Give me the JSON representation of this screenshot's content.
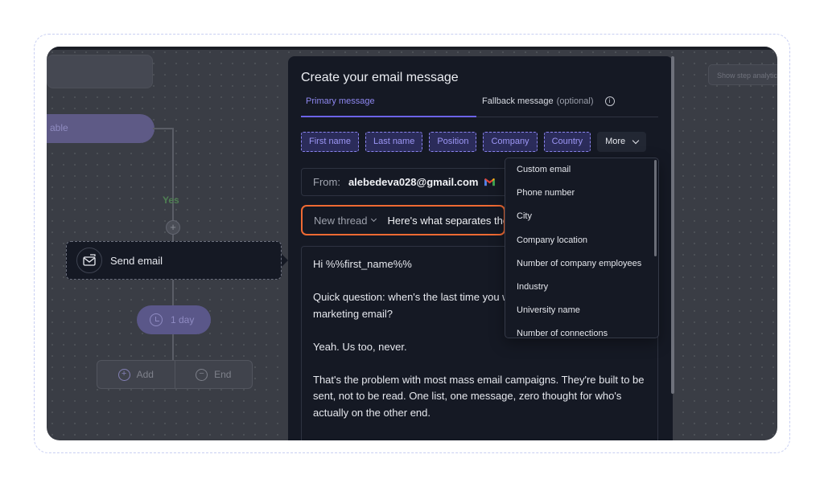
{
  "canvas": {
    "trigger_label": "able",
    "yes_label": "Yes",
    "send_node_label": "Send email",
    "delay_label": "1 day",
    "add_label": "Add",
    "end_label": "End",
    "stats_button": "Show step analytics"
  },
  "modal": {
    "title": "Create your email message",
    "tabs": {
      "primary": "Primary message",
      "fallback": "Fallback message",
      "fallback_hint": "(optional)"
    },
    "variables": [
      "First name",
      "Last name",
      "Position",
      "Company",
      "Country"
    ],
    "more_label": "More",
    "from": {
      "label": "From:",
      "email": "alebedeva028@gmail.com"
    },
    "thread": {
      "select": "New thread",
      "subject": "Here's what separates the"
    },
    "body": [
      "Hi %%first_name%%",
      "Quick question: when's the last time you were excited about opening a marketing email?",
      "Yeah. Us too, never.",
      "That's the problem with most mass email campaigns. They're built to be sent, not to be read. One list, one message, zero thought for who's actually on the other end."
    ]
  },
  "more_menu": {
    "items": [
      "Custom email",
      "Phone number",
      "City",
      "Company location",
      "Number of company employees",
      "Industry",
      "University name",
      "Number of connections"
    ]
  },
  "colors": {
    "accent": "#8b84ef",
    "highlight": "#f06a33",
    "modal_bg": "#151924"
  }
}
